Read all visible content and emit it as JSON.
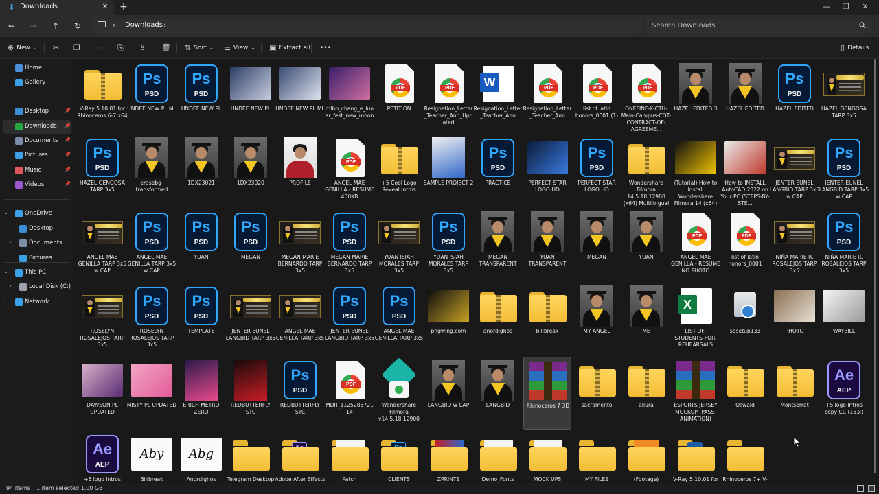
{
  "window": {
    "tab_title": "Downloads",
    "new_tab": "+",
    "close_tab": "✕",
    "minimize": "—",
    "maximize": "❐",
    "close": "✕"
  },
  "address": {
    "path": "Downloads",
    "search_placeholder": "Search Downloads"
  },
  "commands": {
    "new": "New",
    "sort": "Sort",
    "view": "View",
    "extract_all": "Extract all",
    "more": "•••",
    "details": "Details"
  },
  "sidebar": {
    "items": [
      {
        "label": "Home",
        "icon": "home-icon",
        "color": "#4a90d9"
      },
      {
        "label": "Gallery",
        "icon": "gallery-icon",
        "color": "#3aa0e8"
      },
      {
        "label": "Desktop",
        "icon": "desktop-icon",
        "color": "#3a8fd8",
        "pinned": true
      },
      {
        "label": "Downloads",
        "icon": "download-icon",
        "color": "#28a745",
        "pinned": true,
        "selected": true
      },
      {
        "label": "Documents",
        "icon": "documents-icon",
        "color": "#7b8ea8",
        "pinned": true
      },
      {
        "label": "Pictures",
        "icon": "pictures-icon",
        "color": "#3aa0e8",
        "pinned": true
      },
      {
        "label": "Music",
        "icon": "music-icon",
        "color": "#e0565b",
        "pinned": true
      },
      {
        "label": "Videos",
        "icon": "videos-icon",
        "color": "#9b59d0",
        "pinned": true
      },
      {
        "label": "OneDrive",
        "icon": "onedrive-icon",
        "color": "#3aa0e8"
      },
      {
        "label": "Desktop",
        "icon": "desktop-icon",
        "color": "#3a8fd8"
      },
      {
        "label": "Documents",
        "icon": "documents-icon",
        "color": "#7b8ea8"
      },
      {
        "label": "Pictures",
        "icon": "pictures-icon",
        "color": "#3aa0e8"
      },
      {
        "label": "This PC",
        "icon": "pc-icon",
        "color": "#3aa0e8"
      },
      {
        "label": "Local Disk (C:)",
        "icon": "disk-icon",
        "color": "#9aa3ad"
      },
      {
        "label": "Network",
        "icon": "network-icon",
        "color": "#3aa0e8"
      }
    ]
  },
  "files": [
    {
      "name": "V-Ray 5.10.01 for Rhinoceros 6-7 x64",
      "type": "zip"
    },
    {
      "name": "UNDEE NEW PL ML",
      "type": "psd"
    },
    {
      "name": "UNDEE NEW PL",
      "type": "psd"
    },
    {
      "name": "UNDEE NEW PL",
      "type": "image",
      "c1": "#2c3e66",
      "c2": "#c9cfe0"
    },
    {
      "name": "UNDEE NEW PL ML",
      "type": "image",
      "c1": "#3b4d75",
      "c2": "#dfe3ee"
    },
    {
      "name": "mlbb_chang_e_lunar_fest_new_moon",
      "type": "image",
      "c1": "#3a1f6b",
      "c2": "#d06fa0"
    },
    {
      "name": "PETITION",
      "type": "pdf"
    },
    {
      "name": "Resignation_Letter_Teacher_Ann_Updated",
      "type": "pdf"
    },
    {
      "name": "Resignation_Letter_Teacher_Ann",
      "type": "word"
    },
    {
      "name": "Resignation_Letter_Teacher_Ann",
      "type": "pdf"
    },
    {
      "name": "list of latin honors_0001 (1)",
      "type": "pdf"
    },
    {
      "name": "ONEFINE-X-CTU-Main-Campus-COT-CONTRACT-OF-AGREEME...",
      "type": "pdf"
    },
    {
      "name": "HAZEL EDITED 3",
      "type": "photo"
    },
    {
      "name": "HAZEL EDITED",
      "type": "photo"
    },
    {
      "name": "HAZEL EDITED",
      "type": "psd"
    },
    {
      "name": "HAZEL GENGOSA TARP 3x5",
      "type": "tarp"
    },
    {
      "name": "HAZEL GENGOSA TARP 3x5",
      "type": "psd"
    },
    {
      "name": "erasebg-transformed",
      "type": "photo"
    },
    {
      "name": "1DX23021",
      "type": "photo"
    },
    {
      "name": "1DX23020",
      "type": "photo"
    },
    {
      "name": "PROFILE",
      "type": "portrait"
    },
    {
      "name": "ANGEL MAE GENILLA - RESUME 400KB",
      "type": "pdf"
    },
    {
      "name": "+5 Cool Logo Reveal Intros",
      "type": "zip"
    },
    {
      "name": "SAMPLE PROJECT 2",
      "type": "tallimg",
      "c1": "#f0f0f0",
      "c2": "#2f66c9"
    },
    {
      "name": "PRACTICE",
      "type": "psd"
    },
    {
      "name": "PERFECT STAR LOGO HD",
      "type": "image",
      "c1": "#0b1a3a",
      "c2": "#3a7be0"
    },
    {
      "name": "PERFECT STAR LOGO HD",
      "type": "psd"
    },
    {
      "name": "Wondershare Filmora 14.5.18.12900 (x64) Multilingual",
      "type": "zip"
    },
    {
      "name": "(Tutorial) How to Install Wondershare Filmora 14 (x64)",
      "type": "image",
      "c1": "#111111",
      "c2": "#f2c300"
    },
    {
      "name": "How to INSTALL AutoCAD 2022 on Your PC (STEPS-BY-STE...",
      "type": "image",
      "c1": "#e9e9e9",
      "c2": "#c0392b"
    },
    {
      "name": "JENTER EUNEL LANGBID TARP 3x5 w CAP",
      "type": "tarp"
    },
    {
      "name": "JENTER EUNEL LANGBID TARP 3x5 w CAP",
      "type": "psd"
    },
    {
      "name": "ANGEL MAE GENILLA TARP 3x5 w CAP",
      "type": "tarp"
    },
    {
      "name": "ANGEL MAE GENILLA TARP 3x5 w CAP",
      "type": "psd"
    },
    {
      "name": "YUAN",
      "type": "psd"
    },
    {
      "name": "MEGAN",
      "type": "psd"
    },
    {
      "name": "MEGAN MARIE BERNARDO TARP 3x5",
      "type": "tarp"
    },
    {
      "name": "MEGAN MARIE BERNARDO TARP 3x5",
      "type": "psd"
    },
    {
      "name": "YUAN ISIAH MORALES TARP 3x5",
      "type": "tarp"
    },
    {
      "name": "YUAN ISIAH MORALES TARP 3x5",
      "type": "psd"
    },
    {
      "name": "MEGAN TRANSPARENT",
      "type": "photo"
    },
    {
      "name": "YUAN TRANSPARENT",
      "type": "photo"
    },
    {
      "name": "MEGAN",
      "type": "photo"
    },
    {
      "name": "YUAN",
      "type": "photo"
    },
    {
      "name": "ANGEL MAE GENILLA - RESUME NO PHOTO",
      "type": "pdf"
    },
    {
      "name": "list of latin honors_0001",
      "type": "pdf"
    },
    {
      "name": "NIÑA MARIE R. ROSALEJOS TARP 3x5",
      "type": "tarp"
    },
    {
      "name": "NIÑA MARIE R. ROSALEJOS TARP 3x5",
      "type": "psd"
    },
    {
      "name": "ROSELYN ROSALEJOS TARP 3x5",
      "type": "tarp"
    },
    {
      "name": "ROSELYN ROSALEJOS TARP 3x5",
      "type": "psd"
    },
    {
      "name": "TEMPLATE",
      "type": "psd"
    },
    {
      "name": "JENTER EUNEL LANGBID TARP 3x5",
      "type": "tarp"
    },
    {
      "name": "ANGEL MAE GENILLA TARP 3x5",
      "type": "tarp"
    },
    {
      "name": "JENTER EUNEL LANGBID TARP 3x5",
      "type": "psd"
    },
    {
      "name": "ANGEL MAE GENILLA TARP 3x5",
      "type": "psd"
    },
    {
      "name": "pngwing.com",
      "type": "image",
      "c1": "#0d0d0d",
      "c2": "#c9a227"
    },
    {
      "name": "anordighos",
      "type": "zip"
    },
    {
      "name": "billbreak",
      "type": "zip"
    },
    {
      "name": "MY ANGEL",
      "type": "photo"
    },
    {
      "name": "ME",
      "type": "photo"
    },
    {
      "name": "LIST-OF-STUDENTS-FOR-REHEARSALS",
      "type": "excel"
    },
    {
      "name": "spsetup133",
      "type": "setup"
    },
    {
      "name": "PHOTO",
      "type": "image",
      "c1": "#8a6e52",
      "c2": "#e8e1d6"
    },
    {
      "name": "WAYBILL",
      "type": "image",
      "c1": "#f5f5f5",
      "c2": "#9a9a9a"
    },
    {
      "name": "DAWSON PL UPDATED",
      "type": "image",
      "c1": "#d9b0c9",
      "c2": "#5a2d73"
    },
    {
      "name": "MISTY PL UPDATED",
      "type": "image",
      "c1": "#f2a6c4",
      "c2": "#e35b99"
    },
    {
      "name": "ERICH METRO ZERO",
      "type": "tallimg",
      "c1": "#2a1a4a",
      "c2": "#e84a8c"
    },
    {
      "name": "REDBUTTERFLY STC",
      "type": "tallimg",
      "c1": "#1a0a0a",
      "c2": "#c81d25"
    },
    {
      "name": "REDBUTTERFLY STC",
      "type": "psd"
    },
    {
      "name": "MDR_112528572114",
      "type": "pdf"
    },
    {
      "name": "Wondershare Filmora v14.5.18.12900",
      "type": "filmora"
    },
    {
      "name": "LANGBID w CAP",
      "type": "photo"
    },
    {
      "name": "LANGBID",
      "type": "photo"
    },
    {
      "name": "Rhinoceros 7 3D",
      "type": "rar",
      "selected": true
    },
    {
      "name": "sacramento",
      "type": "zip"
    },
    {
      "name": "allura",
      "type": "zip"
    },
    {
      "name": "ESPORTS JERSEY MOCKUP (PASS-ANIMATION)",
      "type": "rar"
    },
    {
      "name": "Oswald",
      "type": "zip"
    },
    {
      "name": "Montserrat",
      "type": "zip"
    },
    {
      "name": "+5 logo Intros copy CC (15.x)",
      "type": "aep"
    },
    {
      "name": "+5 logo Intros",
      "type": "aep"
    },
    {
      "name": "Billbreak",
      "type": "font",
      "glyph": "Aby"
    },
    {
      "name": "Anordighos",
      "type": "font",
      "glyph": "Abg"
    },
    {
      "name": "Telegram Desktop",
      "type": "folder"
    },
    {
      "name": "Adobe After Effects Auto-Save",
      "type": "folder",
      "badge": "Ae"
    },
    {
      "name": "Patch",
      "type": "folder",
      "paper": true
    },
    {
      "name": "CLIENTS",
      "type": "folder",
      "badge": "Ps"
    },
    {
      "name": "ZPRINTS",
      "type": "folder",
      "badge": "img"
    },
    {
      "name": "Demo_Fonts",
      "type": "folder",
      "paper": true
    },
    {
      "name": "MOCK UPS",
      "type": "folder",
      "paper": true
    },
    {
      "name": "MY FILES",
      "type": "folder"
    },
    {
      "name": "(Footage)",
      "type": "folder",
      "badge": "ftg"
    },
    {
      "name": "V-Ray 5.10.01 for Rhinoceros 6-7 x64",
      "type": "folder",
      "badge": "vray"
    },
    {
      "name": "Rhinoceros 7+ V-Ray 5 for rhino 6 and 7",
      "type": "folder"
    }
  ],
  "status": {
    "count": "94 items",
    "selection": "1 item selected  1.00 GB"
  }
}
